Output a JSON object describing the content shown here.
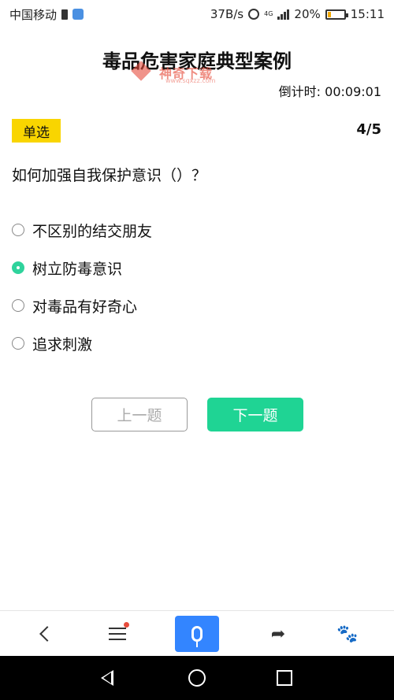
{
  "status_bar": {
    "carrier": "中国移动",
    "net_speed": "37B/s",
    "network_type": "4G",
    "battery_percent_text": "20%",
    "battery_level": 0.2,
    "time": "15:11"
  },
  "header": {
    "title": "毒品危害家庭典型案例",
    "countdown": "倒计时: 00:09:01"
  },
  "watermark": {
    "text": "神奇下载",
    "url": "www.sqxzz.com"
  },
  "question": {
    "type_badge": "单选",
    "progress": "4/5",
    "text": "如何加强自我保护意识（）？",
    "options": [
      {
        "label": "不区别的结交朋友",
        "selected": false
      },
      {
        "label": "树立防毒意识",
        "selected": true
      },
      {
        "label": "对毒品有好奇心",
        "selected": false
      },
      {
        "label": "追求刺激",
        "selected": false
      }
    ]
  },
  "buttons": {
    "prev_label": "上一题",
    "next_label": "下一题"
  },
  "browser_bar": {
    "icons": [
      "back-icon",
      "menu-icon",
      "microphone-icon",
      "share-icon",
      "baidu-paw-icon"
    ]
  },
  "colors": {
    "accent_green": "#1fd494",
    "badge_yellow": "#f9d500",
    "voice_blue": "#3385ff"
  }
}
